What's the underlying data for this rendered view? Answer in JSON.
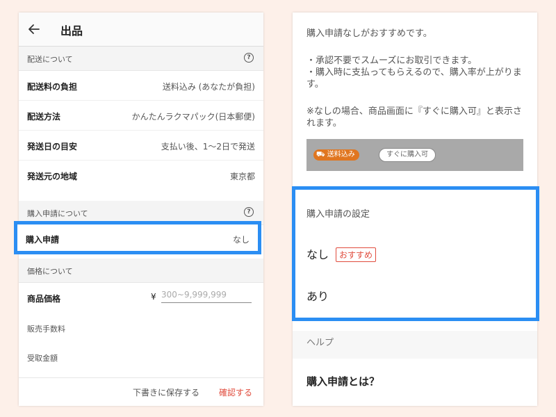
{
  "left": {
    "header": {
      "title": "出品",
      "back_icon": "arrow-left-icon"
    },
    "shipping_section": {
      "title": "配送について",
      "rows": [
        {
          "label": "配送料の負担",
          "value": "送料込み (あなたが負担)"
        },
        {
          "label": "配送方法",
          "value": "かんたんラクマパック(日本郵便)"
        },
        {
          "label": "発送日の目安",
          "value": "支払い後、1〜2日で発送"
        },
        {
          "label": "発送元の地域",
          "value": "東京都"
        }
      ]
    },
    "purchase_section": {
      "title": "購入申請について",
      "row": {
        "label": "購入申請",
        "value": "なし"
      }
    },
    "price_section": {
      "title": "価格について",
      "price_label": "商品価格",
      "currency": "¥",
      "price_placeholder": "300~9,999,999",
      "fee_label": "販売手数料",
      "receive_label": "受取金額"
    },
    "footer": {
      "save_label": "下書きに保存する",
      "confirm_label": "確認する"
    }
  },
  "right": {
    "intro": "購入申請なしがおすすめです。",
    "bullet1": "・承認不要でスムーズにお取引できます。",
    "bullet2": "・購入時に支払ってもらえるので、購入率が上がります。",
    "note": "※なしの場合、商品画面に『すぐに購入可』と表示されます。",
    "preview": {
      "shipping_badge": "送料込み",
      "buy_badge": "すぐに購入可"
    },
    "settings": {
      "title": "購入申請の設定",
      "option_none": "なし",
      "recommend_badge": "おすすめ",
      "option_yes": "あり"
    },
    "help": {
      "title": "ヘルプ",
      "item": "購入申請とは？"
    }
  },
  "colors": {
    "highlight": "#2b8ef3",
    "accent": "#e04b3c",
    "background": "#fdf0e9"
  }
}
